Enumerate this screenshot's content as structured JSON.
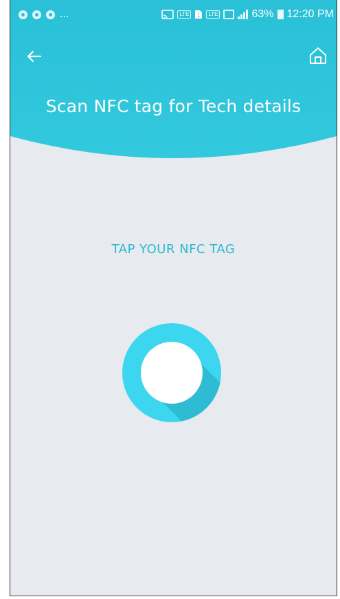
{
  "status_bar": {
    "notification_overflow": "...",
    "battery_percent": "63%",
    "time": "12:20 PM",
    "icons": [
      "notification-icon",
      "notification-icon",
      "notification-icon",
      "cast-icon",
      "volte-icon",
      "sim-icon",
      "lte-icon",
      "signal-icon",
      "battery-icon"
    ]
  },
  "header": {
    "title": "Scan NFC tag for Tech details",
    "back_icon": "arrow-left-icon",
    "home_icon": "home-icon"
  },
  "main": {
    "instruction": "TAP YOUR NFC TAG",
    "scan_icon": "nfc-ring-icon"
  },
  "colors": {
    "header": "#2fc6db",
    "background": "#e7eaef",
    "accent": "#3cd8f0",
    "accent_shadow": "#2ab4cc",
    "instruction_text": "#2fb8cf"
  }
}
